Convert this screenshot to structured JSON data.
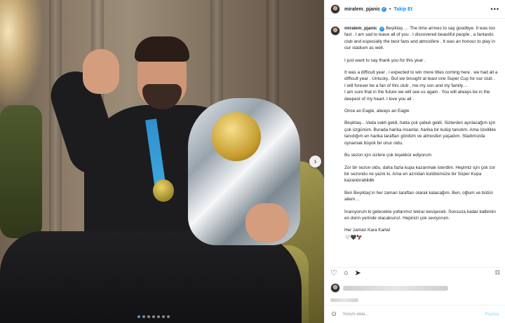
{
  "photo": {
    "alt_subject": "player with trophy",
    "carousel_dots": 7,
    "active_dot": 0,
    "next_glyph": "›"
  },
  "header": {
    "username": "miralem_pjanic",
    "verified_glyph": "✓",
    "separator": "•",
    "follow_label": "Takip Et",
    "more_glyph": "•••"
  },
  "caption": {
    "username": "miralem_pjanic",
    "paragraphs": [
      "Beşiktaş … The time arrives to say goodbye. It was too fast . I am sad to leave all of you . I discovered beautiful people , a fantastic club and especially the best fans and atmosfere . It was an honour to play in our stadium as well.",
      "I just want to say thank you for this year .",
      "It was a difficult year , i expected to win more titles coming here . we had all a difficult year . Unlucky.. But we brought at least one Super Cup for our club .\nI will forever be a fan of this club , me my son and my family…\nI am sure that in the future we will see us again . You will always be in the deepest of my heart. I love you all .",
      "Once an Eagle, always an Eagle",
      "Beşiktaş…Veda vakti geldi, hatta çok çabuk geldi. Sizlerden ayrılacağım için çok üzgünüm. Burada harika insanlar, harika bir kulüp tanıdım. Ama özellikle tanıdığım en harika taraftarı gördüm ve atmosferi yaşadım. Stadımızda oynamak büyük bir onur oldu.",
      "Bu sezon için sizlere çok teşekkür ediyorum",
      "Zor bir sezon oldu, daha fazla kupa kazanmak isterdim. Hepimiz için çok zor bir sezondu ne yazık ki. Ama en azından kulübümüze bir Süper Kupa kazandırabildik",
      "Ben Beşiktaş'ın her zaman taraftarı olarak kalacağım. Ben, oğlum ve bütün ailem…",
      "İnanıyorum ki gelecekte yollarımız tekrar kesişecek. Sonsuza kadar kalbimin en derin yerinde olacaksınız. Hepinizi çok seviyorum.",
      "Her zaman Kara Kartal"
    ],
    "hearts": "🤍🖤🦅"
  },
  "actions": {
    "like_icon": "♡",
    "comment_icon": "○",
    "share_icon": "➤",
    "bookmark_icon": "⌑"
  },
  "comment": {
    "emoji_icon": "☺",
    "placeholder": "Yorum ekle...",
    "post_label": "Paylaş"
  }
}
